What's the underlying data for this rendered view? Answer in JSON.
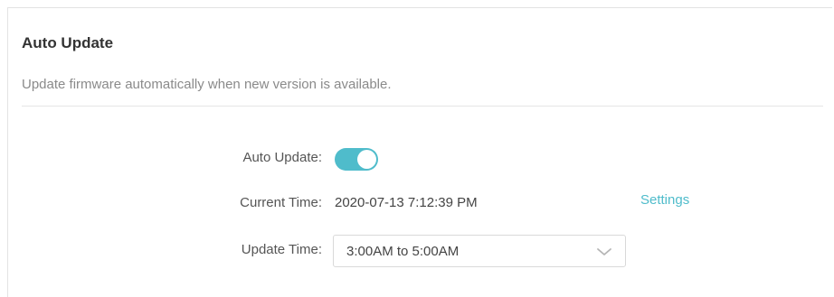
{
  "section": {
    "title": "Auto Update",
    "description": "Update firmware automatically when new version is available."
  },
  "form": {
    "auto_update": {
      "label": "Auto Update:",
      "enabled": true,
      "accent_color": "#4fbccb"
    },
    "current_time": {
      "label": "Current Time:",
      "value": "2020-07-13 7:12:39 PM",
      "settings_link": "Settings"
    },
    "update_time": {
      "label": "Update Time:",
      "selected": "3:00AM to 5:00AM",
      "icon": "chevron-down-icon"
    }
  }
}
